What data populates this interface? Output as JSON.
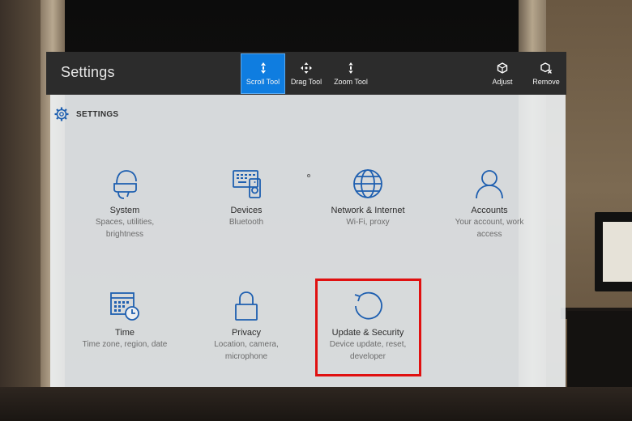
{
  "titlebar": {
    "title": "Settings",
    "tools": {
      "scroll": "Scroll Tool",
      "drag": "Drag Tool",
      "zoom": "Zoom Tool",
      "adjust": "Adjust",
      "remove": "Remove"
    },
    "active_tool": "Scroll Tool"
  },
  "panel": {
    "header": "SETTINGS",
    "tiles": [
      {
        "name": "System",
        "desc": [
          "Spaces, utilities,",
          "brightness"
        ],
        "icon": "headset-icon"
      },
      {
        "name": "Devices",
        "desc": [
          "Bluetooth"
        ],
        "icon": "devices-icon"
      },
      {
        "name": "Network & Internet",
        "desc": [
          "Wi-Fi, proxy"
        ],
        "icon": "globe-icon"
      },
      {
        "name": "Accounts",
        "desc": [
          "Your account, work",
          "access"
        ],
        "icon": "person-icon"
      },
      {
        "name": "Time",
        "desc": [
          "Time zone, region, date"
        ],
        "icon": "calendar-clock-icon"
      },
      {
        "name": "Privacy",
        "desc": [
          "Location, camera,",
          "microphone"
        ],
        "icon": "lock-icon"
      },
      {
        "name": "Update & Security",
        "desc": [
          "Device update, reset,",
          "developer"
        ],
        "icon": "refresh-icon"
      }
    ],
    "highlighted_tile": "Update & Security"
  },
  "colors": {
    "accent": "#0f7de0",
    "icon_blue": "#1e5fb0",
    "highlight": "#e01010",
    "titlebar_bg": "#2c2c2c"
  }
}
